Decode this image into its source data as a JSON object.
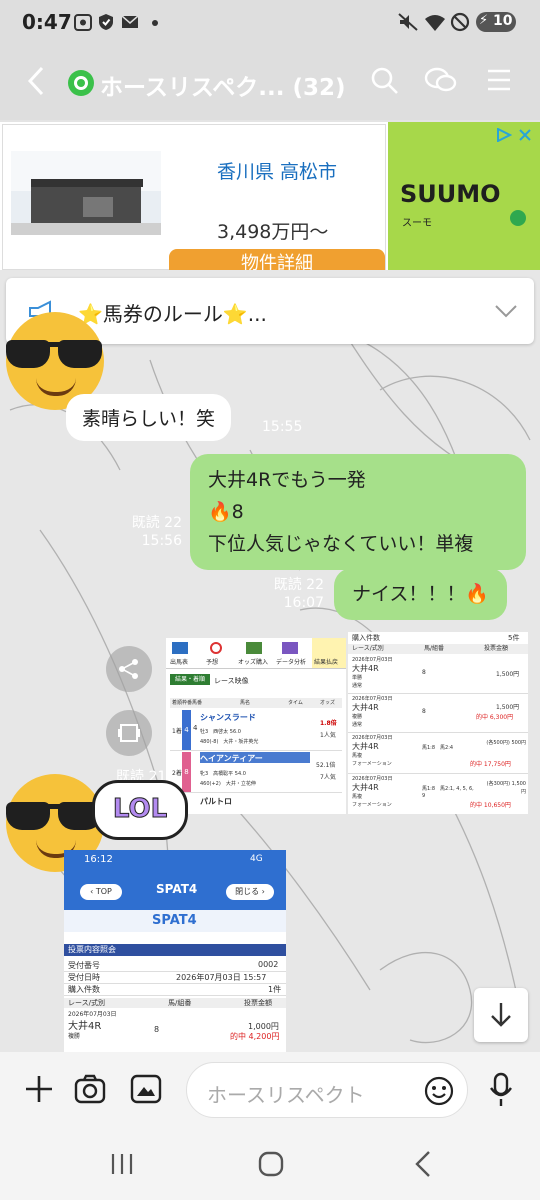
{
  "status": {
    "time": "0:47",
    "battery": "10"
  },
  "header": {
    "title": "ホースリスペク...",
    "count": "(32)"
  },
  "ad": {
    "location": "香川県 高松市",
    "price": "3,498万円～",
    "cta": "物件詳細",
    "brand": "SUUMO",
    "brand_sub": "スーモ"
  },
  "announcement": {
    "text": "⭐馬券のルール⭐..."
  },
  "messages": [
    {
      "side": "left",
      "text": "素晴らしい！笑",
      "time": "15:55"
    },
    {
      "side": "right",
      "lines": [
        "大井4Rでもう一発",
        "🔥8",
        "下位人気じゃなくていい！単複"
      ],
      "read": "既読 22",
      "time": "15:56"
    },
    {
      "side": "right",
      "text": "ナイス！！！🔥",
      "read": "既読 22",
      "time": "16:07"
    }
  ],
  "image_meta": {
    "read": "既読 21"
  },
  "sticker": {
    "text": "LOL"
  },
  "shot1": {
    "tabs": [
      "出馬表",
      "予想",
      "オッズ購入",
      "データ分析",
      "結果払戻"
    ],
    "subtabs": [
      "結果・着順",
      "レース映像"
    ],
    "headers": [
      "着順",
      "枠番",
      "馬番",
      "馬名",
      "タイム",
      "オッズ"
    ],
    "rows": [
      {
        "pos": "1着",
        "waku": "4",
        "num": "4",
        "name": "シャンスラード",
        "info": "牡3　西啓太 56.0",
        "weight": "480(-8)　大井・坂井英光",
        "odds": "1.8倍",
        "pop": "1人気"
      },
      {
        "pos": "2着",
        "waku": "8",
        "num": "8",
        "name": "ヘイアンティアー",
        "info": "牝3　高橋聡平 54.0",
        "weight": "460(+2)　大井・立花伸",
        "odds": "52.1倍",
        "pop": "7人気"
      },
      {
        "pos": "",
        "waku": "",
        "num": "",
        "name": "パルトロ",
        "info": "",
        "weight": "",
        "odds": "",
        "pop": ""
      }
    ]
  },
  "shot2": {
    "title": "購入件数",
    "count": "5件",
    "headers": [
      "レース/式別",
      "馬/組番",
      "投票金額"
    ],
    "rows": [
      {
        "date": "2026年07月03日",
        "race": "大井4R",
        "type": "単勝",
        "method": "通常",
        "horse": "8",
        "amount": "1,500円",
        "win": ""
      },
      {
        "date": "2026年07月03日",
        "race": "大井4R",
        "type": "複勝",
        "method": "通常",
        "horse": "8",
        "amount": "1,500円",
        "win": "的中 6,300円"
      },
      {
        "date": "2026年07月03日",
        "race": "大井4R",
        "type": "馬複",
        "method": "フォーメーション",
        "horse": "馬1:8　馬2:4",
        "amount": "(各500円) 500円",
        "win": "的中 17,750円"
      },
      {
        "date": "2026年07月03日",
        "race": "大井4R",
        "type": "馬複",
        "method": "フォーメーション",
        "horse": "馬1:8　馬2:1, 4, 5, 6, 9",
        "amount": "(各300円) 1,500円",
        "win": "的中 10,650円"
      }
    ]
  },
  "shot3": {
    "time": "16:12",
    "signal": "4G",
    "top_btn": "TOP",
    "close_btn": "閉じる",
    "logo": "SPAT4",
    "section": "投票内容照会",
    "fields": [
      {
        "label": "受付番号",
        "value": "0002"
      },
      {
        "label": "受付日時",
        "value": "2026年07月03日 15:57"
      },
      {
        "label": "購入件数",
        "value": "1件"
      }
    ],
    "headers": [
      "レース/式別",
      "馬/組番",
      "投票金額"
    ],
    "row": {
      "date": "2026年07月03日",
      "race": "大井4R",
      "type": "複勝",
      "horse": "8",
      "amount": "1,000円",
      "win": "的中 4,200円"
    }
  },
  "input": {
    "placeholder": "ホースリスペクト"
  }
}
